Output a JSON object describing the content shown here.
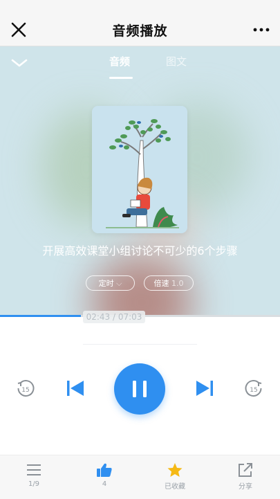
{
  "nav": {
    "title": "音频播放"
  },
  "tabs": [
    {
      "label": "音频",
      "active": true
    },
    {
      "label": "图文",
      "active": false
    }
  ],
  "track": {
    "title": "开展高效课堂小组讨论不可少的6个步骤"
  },
  "controls": {
    "timer_label": "定时",
    "timer_chevron": "⌵",
    "speed_label": "倍速",
    "speed_value": "1.0",
    "skip_back": "15",
    "skip_forward": "15"
  },
  "progress": {
    "current": "02:43",
    "total": "07:03",
    "fraction": 0.29,
    "time_display": "02:43 / 07:03"
  },
  "bottom_bar": {
    "list_label": "1/9",
    "like_label": "4",
    "favorite_label": "已收藏",
    "share_label": "分享"
  },
  "colors": {
    "accent": "#2f8ff0",
    "favorite": "#f5b915",
    "hero": "#cfe4ea"
  },
  "icons": [
    "close-icon",
    "more-icon",
    "chevron-down-icon",
    "rewind-15-icon",
    "previous-icon",
    "pause-icon",
    "next-icon",
    "forward-15-icon",
    "list-icon",
    "thumbs-up-icon",
    "star-icon",
    "share-icon"
  ]
}
